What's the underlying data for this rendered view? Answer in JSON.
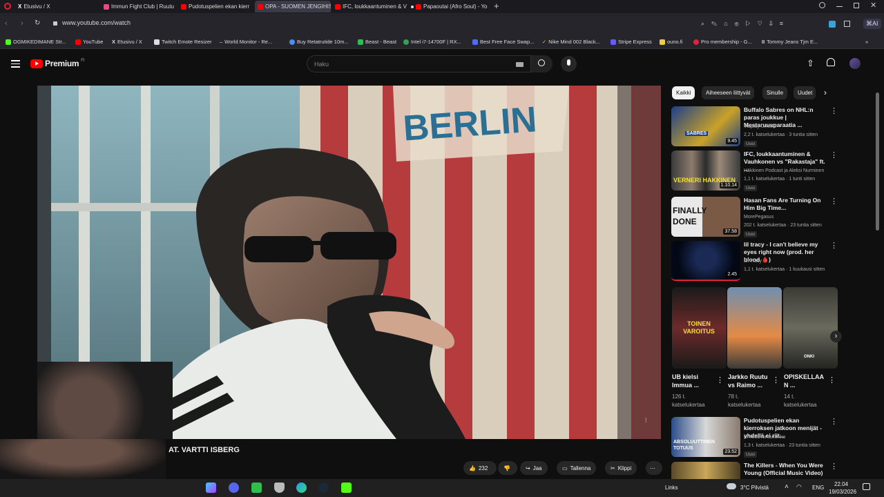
{
  "browser": {
    "tabs": [
      {
        "title": "Etusivu / X"
      },
      {
        "title": "Immun Fight Club | Ruutu"
      },
      {
        "title": "Pudotuspelien ekan kierr"
      },
      {
        "title": "OPA - SUOMEN JENGIHIS"
      },
      {
        "title": "IFC, loukkaantuminen & V"
      },
      {
        "title": "Papaoutai (Afro Soul) - Yo"
      }
    ],
    "url": "www.youtube.com/watch",
    "bookmarks": [
      "OGMIKEDIMANE Str...",
      "YouTube",
      "Etusivu / X",
      "Twitch Emote Resizer",
      "World Monitor - Re...",
      "Buy Retatrutide 10m...",
      "Beast - Beast",
      "Intel i7-14700F | RX...",
      "Best Free Face Swap...",
      "Nike Mind 002 Black...",
      "Stripe Express",
      "ouno.fi",
      "Pro membership - G...",
      "Tommy Jeans Tjm E..."
    ]
  },
  "header": {
    "logo_text": "Premium",
    "logo_region": "FI",
    "search_placeholder": "Haku"
  },
  "video": {
    "title_visible": "AT. VARTTI ISBERG",
    "poster_text": "BERLIN",
    "actions": {
      "likes": "232",
      "share": "Jaa",
      "save": "Tallenna",
      "clip": "Klippi"
    }
  },
  "chips": [
    "Kaikki",
    "Aiheeseen liittyvät",
    "Sinulle",
    "Uudet"
  ],
  "recommendations": [
    {
      "title": "Buffalo Sabres on NHL:n paras joukkue | Mestaruusparaatia ...",
      "channel": "Viaplay Urheilu",
      "meta": "2,2 t. katselukertaa · 3 tuntia sitten",
      "badge": "Uusi",
      "duration": "9.45",
      "thumb_text": "SABRES"
    },
    {
      "title": "IFC, loukkaantuminen & Vauhkonen vs \"Rakastaja\" ft. ...",
      "channel": "Häkkinen Podcast ja Aleksi Nurminen",
      "meta": "1,1 t. katselukertaa · 1 tunti sitten",
      "badge": "Uusi",
      "duration": "1.10.14",
      "thumb_text": "VERNERI HAKKINEN"
    },
    {
      "title": "Hasan Fans Are Turning On Him Big Time...",
      "channel": "MorePegasus",
      "meta": "202 t. katselukertaa · 23 tuntia sitten",
      "badge": "Uusi",
      "duration": "37.58",
      "thumb_text": "FINALLY DONE"
    },
    {
      "title": "lil tracy - I can't believe my eyes right now (prod. her blood 🩸)",
      "channel": "Lil Tracy",
      "meta": "1,1 t. katselukertaa · 1 kuukausi sitten",
      "badge": "",
      "duration": "2.45",
      "thumb_text": ""
    }
  ],
  "shorts": [
    {
      "title": "UB kielsi Immua ...",
      "views": "126 t. katselukertaa",
      "thumb_text": "TOINEN VAROITUS"
    },
    {
      "title": "Jarkko Ruutu vs Raimo ...",
      "views": "78 t. katselukertaa",
      "thumb_text": ""
    },
    {
      "title": "OPISKELLAA N ...",
      "views": "14 t. katselukertaa",
      "thumb_text": "ONKI"
    }
  ],
  "more_recs": [
    {
      "title": "Pudotuspelien ekan kierroksen jatkoon menijät - yhdellä ei riit...",
      "channel": "Urheilurromantiikko",
      "meta": "1,3 t. katselukertaa · 23 tuntia sitten",
      "badge": "Uusi",
      "duration": "23.52",
      "thumb_text": "ABSOLUUTTINEN TOTUUS"
    },
    {
      "title": "The Killers - When You Were Young (Official Music Video)",
      "channel": "",
      "meta": "",
      "badge": "",
      "duration": "",
      "thumb_text": ""
    }
  ],
  "taskbar": {
    "links": "Links",
    "weather": "3°C  Pilvistä",
    "lang": "ENG",
    "time": "22.04",
    "date": "19/03/2026"
  },
  "colors": {
    "yt_red": "#ff0000",
    "background": "#0f0f0f",
    "chip_bg": "#272727"
  }
}
